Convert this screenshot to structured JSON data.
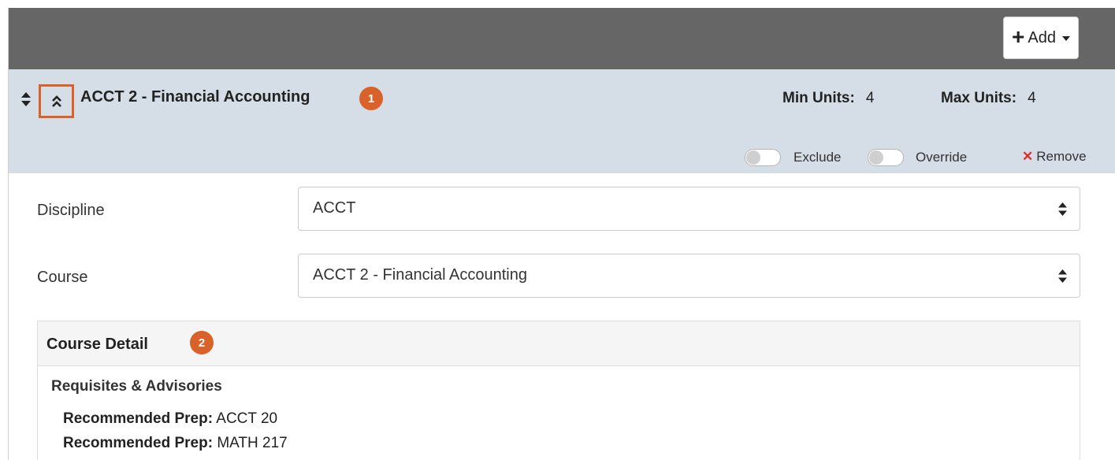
{
  "toolbar": {
    "add_label": "Add"
  },
  "course_header": {
    "title": "ACCT 2 - Financial Accounting",
    "badge1": "1",
    "min_units_label": "Min Units:",
    "min_units_value": "4",
    "max_units_label": "Max Units:",
    "max_units_value": "4",
    "exclude_label": "Exclude",
    "override_label": "Override",
    "remove_label": "Remove"
  },
  "form": {
    "discipline_label": "Discipline",
    "discipline_value": "ACCT",
    "course_label": "Course",
    "course_value": "ACCT 2 - Financial Accounting"
  },
  "course_detail": {
    "title": "Course Detail",
    "badge2": "2",
    "section_title": "Requisites & Advisories",
    "requisites": [
      {
        "label": "Recommended Prep:",
        "value": "ACCT 20"
      },
      {
        "label": "Recommended Prep:",
        "value": "MATH 217"
      }
    ]
  },
  "colors": {
    "topbar": "#666666",
    "header_bg": "#d5dde6",
    "accent_orange": "#d9622b",
    "remove_red": "#e02b2b"
  },
  "icons": [
    "plus-icon",
    "caret-down-icon",
    "sort-icon",
    "double-chevron-up-icon",
    "close-icon",
    "select-arrows-icon"
  ]
}
